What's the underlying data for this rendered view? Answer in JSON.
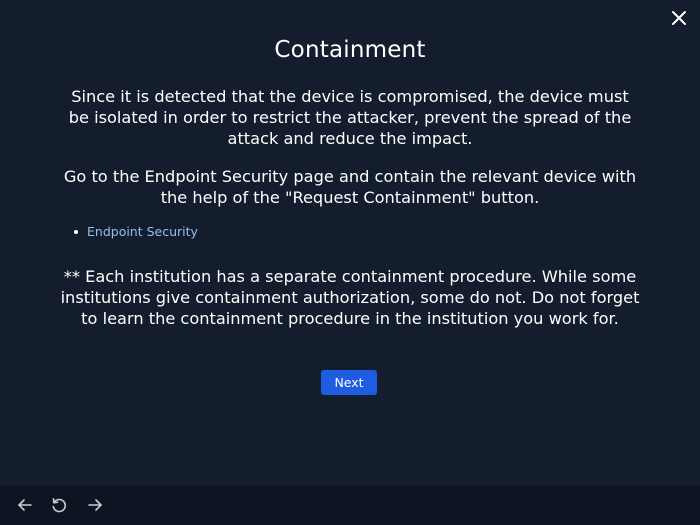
{
  "modal": {
    "title": "Containment",
    "paragraph_1": "Since it is detected that the device is compromised, the device must be isolated in order to restrict the attacker, prevent the spread of the attack and reduce the impact.",
    "paragraph_2": "Go to the Endpoint Security page and contain the relevant device with the help of the \"Request Containment\" button.",
    "links": [
      {
        "label": "Endpoint Security"
      }
    ],
    "paragraph_3": "** Each institution has a separate containment procedure. While some institutions give containment authorization, some do not. Do not forget to learn the containment procedure in the institution you work for.",
    "next_label": "Next",
    "close_icon": "close-icon"
  },
  "bottom_bar": {
    "icons": [
      "arrow-left-icon",
      "replay-icon",
      "arrow-right-icon"
    ]
  },
  "colors": {
    "background": "#141d2e",
    "bottom_bar": "#0d1422",
    "text": "#ffffff",
    "link": "#8ec0f0",
    "primary_button": "#1e5de0"
  }
}
